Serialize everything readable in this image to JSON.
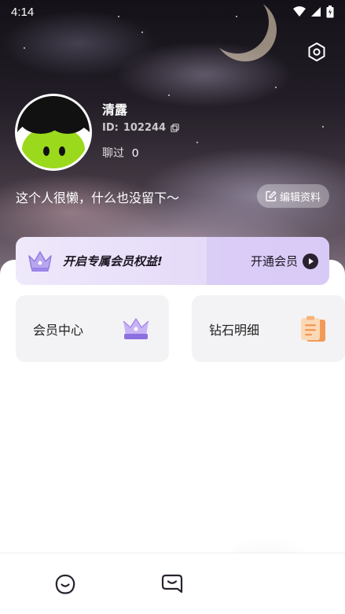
{
  "status_bar": {
    "time": "4:14"
  },
  "profile": {
    "name": "清露",
    "id_label": "ID:",
    "id_value": "102244",
    "chat_label": "聊过",
    "chat_count": "0",
    "bio": "这个人很懒，什么也没留下～",
    "edit_label": "编辑资料"
  },
  "vip_banner": {
    "title": "开启专属会员权益!",
    "action": "开通会员"
  },
  "cards": [
    {
      "label": "会员中心",
      "icon": "crown-icon"
    },
    {
      "label": "钻石明细",
      "icon": "clipboard-icon"
    }
  ],
  "tabs": [
    {
      "icon": "smile-face-icon"
    },
    {
      "icon": "chat-bubble-icon"
    }
  ],
  "colors": {
    "accent": "#2a2230",
    "card_bg": "#f3f3f5",
    "vip_gradient_end": "#dcd0f6"
  }
}
